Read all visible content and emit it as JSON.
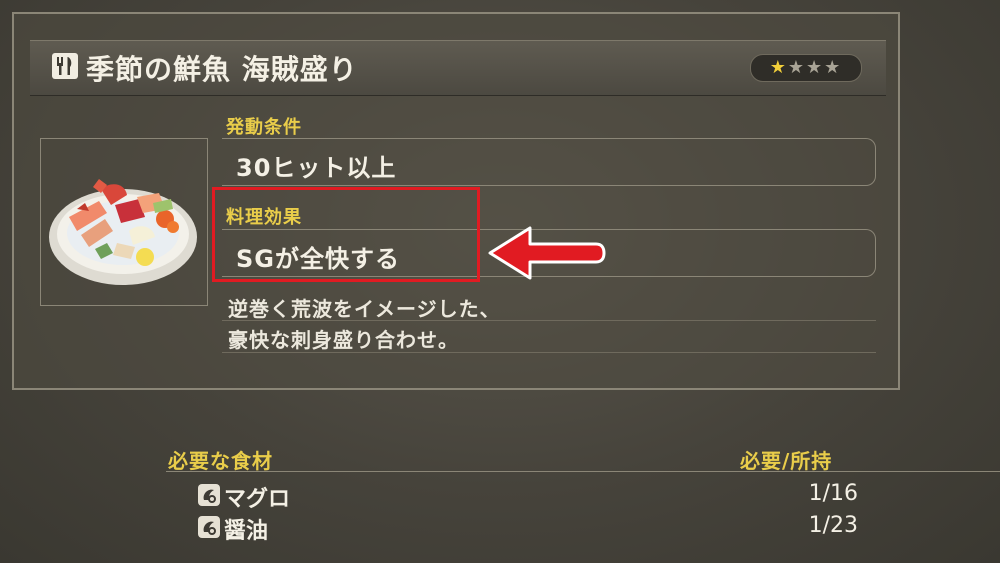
{
  "dish": {
    "title": "季節の鮮魚 海賊盛り",
    "rating_stars": "★",
    "rating_empty": "★★★",
    "rating": 1,
    "rating_max": 4,
    "image": "sashimi-platter"
  },
  "trigger": {
    "label": "発動条件",
    "value": "30ヒット以上"
  },
  "effect": {
    "label": "料理効果",
    "value": "SGが全快する"
  },
  "description": {
    "line1": "逆巻く荒波をイメージした、",
    "line2": "豪快な刺身盛り合わせ。"
  },
  "ingredients": {
    "header": "必要な食材",
    "count_header": "必要/所持",
    "items": [
      {
        "name": "マグロ",
        "count": "1/16",
        "icon": "ingredient-icon"
      },
      {
        "name": "醤油",
        "count": "1/23",
        "icon": "ingredient-icon"
      }
    ]
  },
  "colors": {
    "accent": "#e9cd4a",
    "highlight": "#e11b22",
    "star": "#f2cf3a"
  }
}
